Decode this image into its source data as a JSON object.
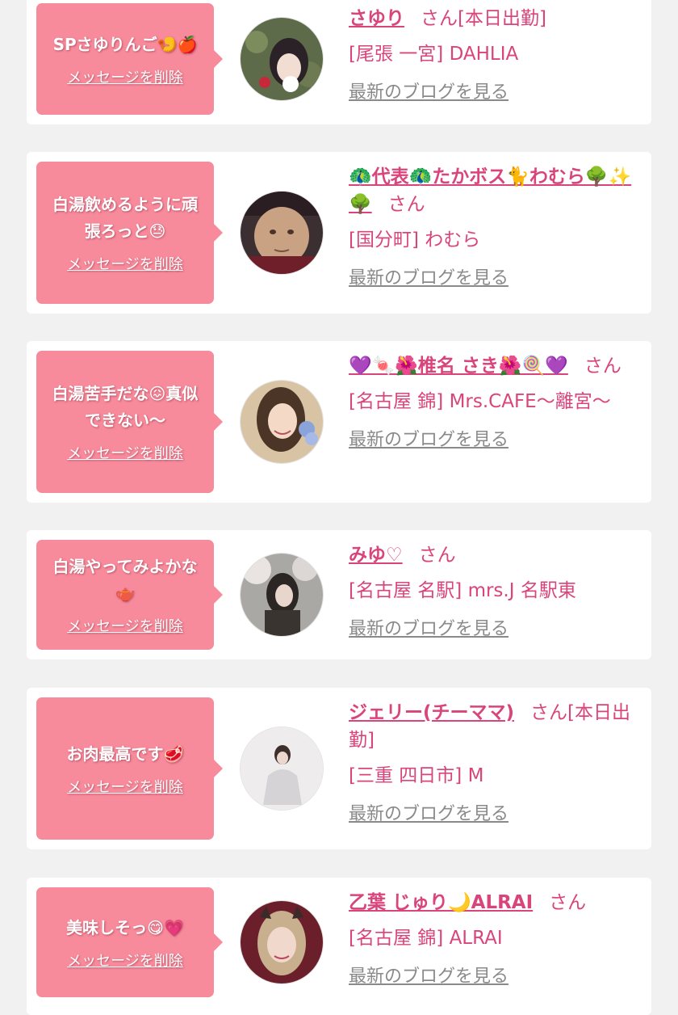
{
  "delete_label": "メッセージを削除",
  "blog_label": "最新のブログを見る",
  "colors": {
    "bubble": "#f78a9b",
    "name": "#d9457a",
    "link_gray": "#8a8a8a",
    "card": "#ffffff",
    "background": "#f1f1f1"
  },
  "entries": [
    {
      "message": "SPさゆりんご🍤🍎",
      "name": "さゆり",
      "suffix": "さん[本日出勤]",
      "shop": "[尾張 一宮] DAHLIA",
      "avatar_icon": "avatar-photo-icon"
    },
    {
      "message": "白湯飲めるように頑張ろっと😓",
      "name": "🦚代表🦚たかボス🐈わむら🌳✨🌳",
      "suffix": "さん",
      "shop": "[国分町] わむら",
      "avatar_icon": "avatar-photo-icon"
    },
    {
      "message": "白湯苦手だな😖真似できない〜",
      "name": "💜🍬🌺椎名 さき🌺🍭💜",
      "suffix": "さん",
      "shop": "[名古屋 錦] Mrs.CAFE〜離宮〜",
      "avatar_icon": "avatar-photo-icon"
    },
    {
      "message": "白湯やってみよかな🫖",
      "name": "みゆ♡",
      "suffix": "さん",
      "shop": "[名古屋 名駅] mrs.J 名駅東",
      "avatar_icon": "avatar-photo-icon"
    },
    {
      "message": "お肉最高です🥩",
      "name": "ジェリー(チーママ)",
      "suffix": "さん[本日出勤]",
      "shop": "[三重 四日市] M",
      "avatar_icon": "avatar-photo-icon"
    },
    {
      "message": "美味しそっ😋💗",
      "name": "乙葉 じゅり🌙ALRAI",
      "suffix": "さん",
      "shop": "[名古屋 錦] ALRAI",
      "avatar_icon": "avatar-photo-icon"
    }
  ]
}
